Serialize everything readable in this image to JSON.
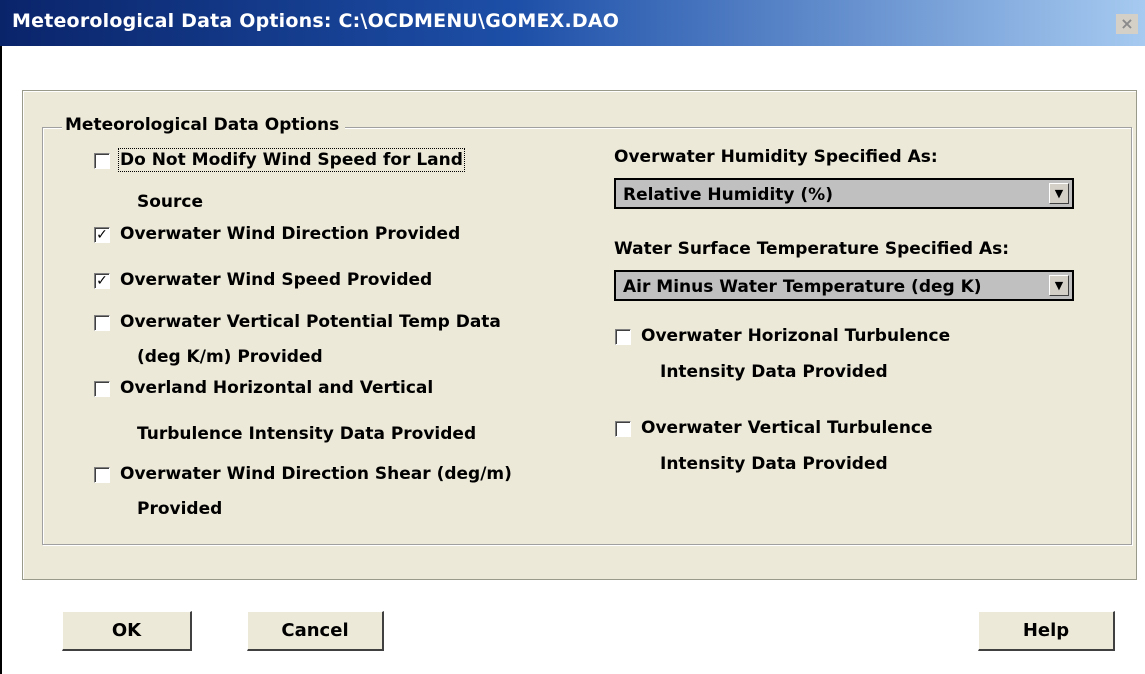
{
  "window": {
    "title": "Meteorological Data Options: C:\\OCDMENU\\GOMEX.DAO",
    "close_glyph": "×"
  },
  "group": {
    "label": "Meteorological Data Options"
  },
  "left_options": [
    {
      "line1": "Do Not Modify Wind Speed for Land",
      "line2": "Source",
      "checked": false
    },
    {
      "line1": "Overwater Wind Direction Provided",
      "line2": "",
      "checked": true
    },
    {
      "line1": "Overwater Wind Speed Provided",
      "line2": "",
      "checked": true
    },
    {
      "line1": "Overwater Vertical Potential Temp Data",
      "line2": "(deg K/m) Provided",
      "checked": false
    },
    {
      "line1": "Overland Horizontal and Vertical",
      "line2": "Turbulence Intensity Data Provided",
      "checked": false
    },
    {
      "line1": "Overwater Wind Direction Shear (deg/m)",
      "line2": "Provided",
      "checked": false
    }
  ],
  "humidity": {
    "label": "Overwater Humidity Specified As:",
    "selected": "Relative Humidity (%)"
  },
  "water_temp": {
    "label": "Water Surface Temperature Specified As:",
    "selected": "Air Minus Water Temperature (deg K)"
  },
  "right_options": [
    {
      "line1": "Overwater Horizonal Turbulence",
      "line2": "Intensity Data Provided",
      "checked": false
    },
    {
      "line1": "Overwater Vertical Turbulence",
      "line2": "Intensity Data Provided",
      "checked": false
    }
  ],
  "buttons": {
    "ok": "OK",
    "cancel": "Cancel",
    "help": "Help"
  }
}
